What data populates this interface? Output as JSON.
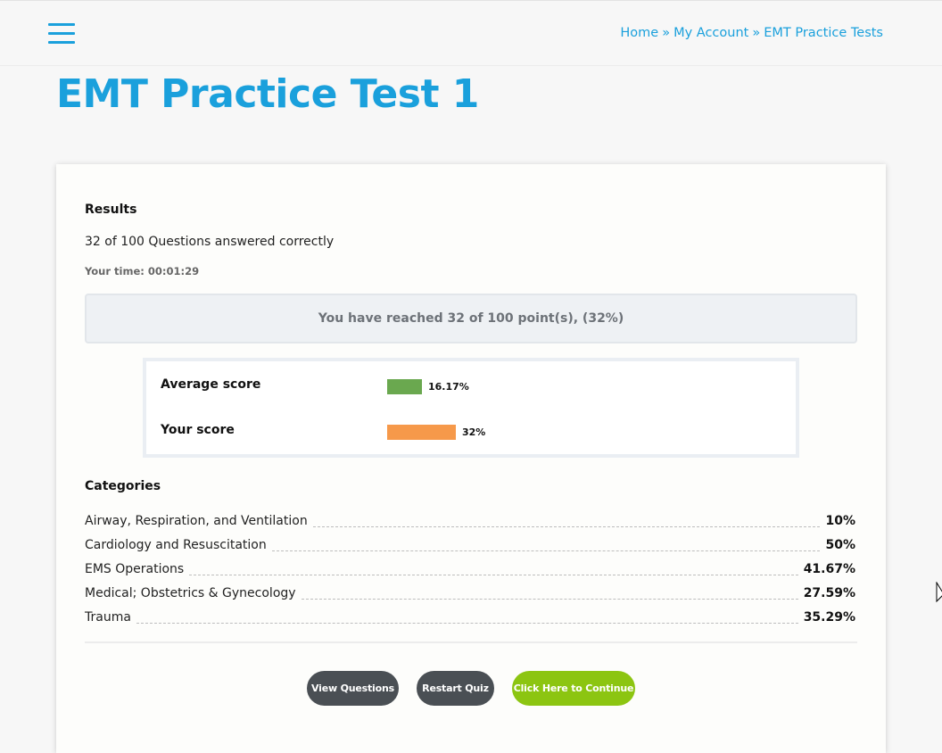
{
  "header": {
    "breadcrumb": [
      {
        "label": "Home"
      },
      {
        "label": "My Account"
      },
      {
        "label": "EMT Practice Tests"
      }
    ],
    "separator": "»"
  },
  "page": {
    "title": "EMT Practice Test 1"
  },
  "results": {
    "heading": "Results",
    "answered": "32 of 100 Questions answered correctly",
    "time": "Your time: 00:01:29",
    "reached": "You have reached 32 of 100 point(s), (32%)"
  },
  "scores": {
    "average": {
      "label": "Average score",
      "value": "16.17%",
      "percent": 16.17,
      "color": "#6aa84f"
    },
    "yours": {
      "label": "Your score",
      "value": "32%",
      "percent": 32,
      "color": "#f6994a"
    }
  },
  "categories": {
    "heading": "Categories",
    "items": [
      {
        "name": "Airway, Respiration, and Ventilation",
        "value": "10%"
      },
      {
        "name": "Cardiology and Resuscitation",
        "value": "50%"
      },
      {
        "name": "EMS Operations",
        "value": "41.67%"
      },
      {
        "name": "Medical; Obstetrics & Gynecology",
        "value": "27.59%"
      },
      {
        "name": "Trauma",
        "value": "35.29%"
      }
    ]
  },
  "buttons": {
    "view_questions": "View Questions",
    "restart_quiz": "Restart Quiz",
    "continue": "Click Here to Continue"
  },
  "colors": {
    "accent": "#1aa0dc",
    "button_dark": "#4a4f54",
    "button_green": "#8cc511"
  }
}
